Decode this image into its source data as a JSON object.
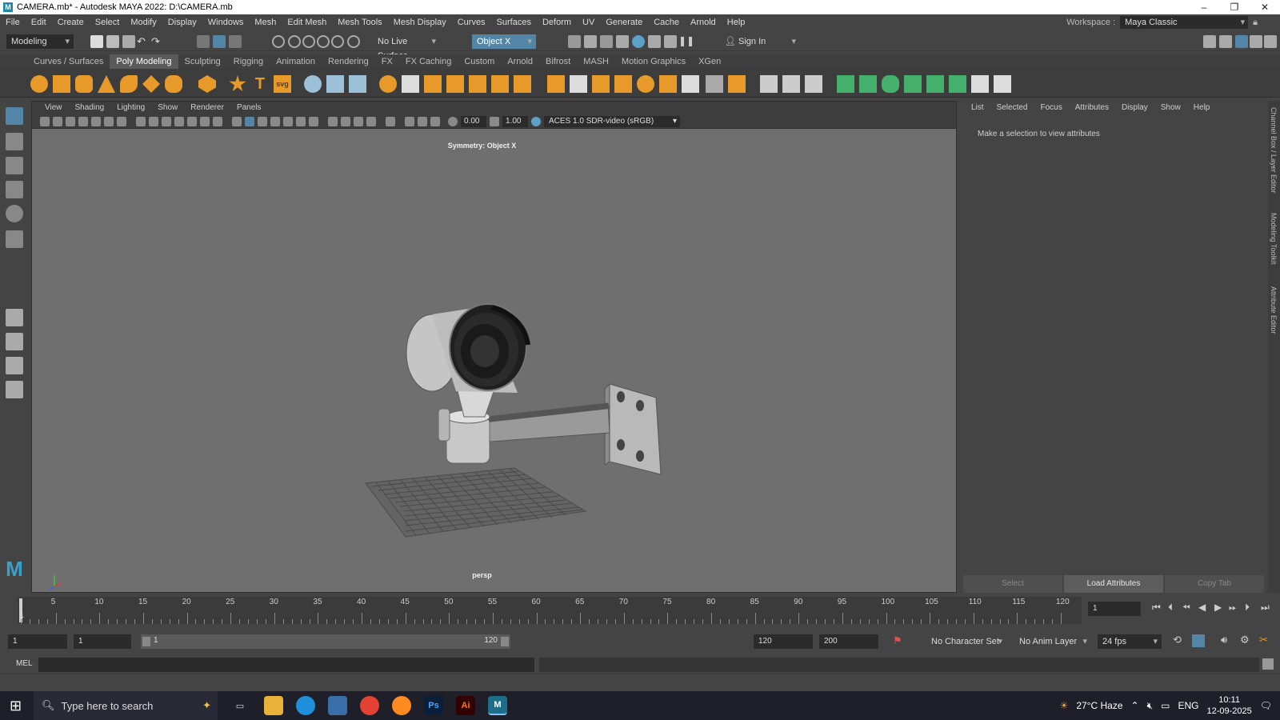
{
  "window": {
    "title": "CAMERA.mb* - Autodesk MAYA 2022: D:\\CAMERA.mb",
    "controls": [
      "–",
      "❐",
      "✕"
    ]
  },
  "menubar": {
    "items": [
      "File",
      "Edit",
      "Create",
      "Select",
      "Modify",
      "Display",
      "Windows",
      "Mesh",
      "Edit Mesh",
      "Mesh Tools",
      "Mesh Display",
      "Curves",
      "Surfaces",
      "Deform",
      "UV",
      "Generate",
      "Cache",
      "Arnold",
      "Help"
    ],
    "workspace_label": "Workspace :",
    "workspace_value": "Maya Classic"
  },
  "statusline": {
    "menuset": "Modeling",
    "live_surface": "No Live Surface",
    "symmetry": "Object X",
    "sign_in": "Sign In"
  },
  "shelf": {
    "tabs": [
      "Curves / Surfaces",
      "Poly Modeling",
      "Sculpting",
      "Rigging",
      "Animation",
      "Rendering",
      "FX",
      "FX Caching",
      "Custom",
      "Arnold",
      "Bifrost",
      "MASH",
      "Motion Graphics",
      "XGen"
    ],
    "active_tab": "Poly Modeling",
    "svg_label": "svg",
    "text_label": "T"
  },
  "viewport": {
    "menu": [
      "View",
      "Shading",
      "Lighting",
      "Show",
      "Renderer",
      "Panels"
    ],
    "exposure": "0.00",
    "gamma": "1.00",
    "colorspace": "ACES 1.0 SDR-video (sRGB)",
    "symmetry_label": "Symmetry: Object X",
    "camera_label": "persp"
  },
  "attribute_editor": {
    "menu": [
      "List",
      "Selected",
      "Focus",
      "Attributes",
      "Display",
      "Show",
      "Help"
    ],
    "message": "Make a selection to view attributes",
    "buttons": [
      "Select",
      "Load Attributes",
      "Copy Tab"
    ],
    "side_tabs": [
      "Channel Box / Layer Editor",
      "Modeling Toolkit",
      "Attribute Editor"
    ]
  },
  "timeslider": {
    "ticks": [
      "5",
      "10",
      "15",
      "20",
      "25",
      "30",
      "35",
      "40",
      "45",
      "50",
      "55",
      "60",
      "65",
      "70",
      "75",
      "80",
      "85",
      "90",
      "95",
      "100",
      "105",
      "110",
      "115",
      "120"
    ],
    "current_frame_marker": "1",
    "current_frame": "1"
  },
  "rangeslider": {
    "start": "1",
    "anim_start": "1",
    "range_start": "1",
    "range_end": "120",
    "anim_end": "120",
    "end": "200",
    "character_set": "No Character Set",
    "anim_layer": "No Anim Layer",
    "fps": "24 fps"
  },
  "command_line": {
    "label": "MEL"
  },
  "taskbar": {
    "search_placeholder": "Type here to search",
    "weather": "27°C  Haze",
    "language": "ENG",
    "time": "10:11",
    "date": "12-09-2025"
  },
  "colors": {
    "accent_blue": "#5285a6",
    "shelf_orange": "#e79a2a",
    "shelf_green": "#45b06b",
    "viewport_bg": "#6f6f6f"
  }
}
